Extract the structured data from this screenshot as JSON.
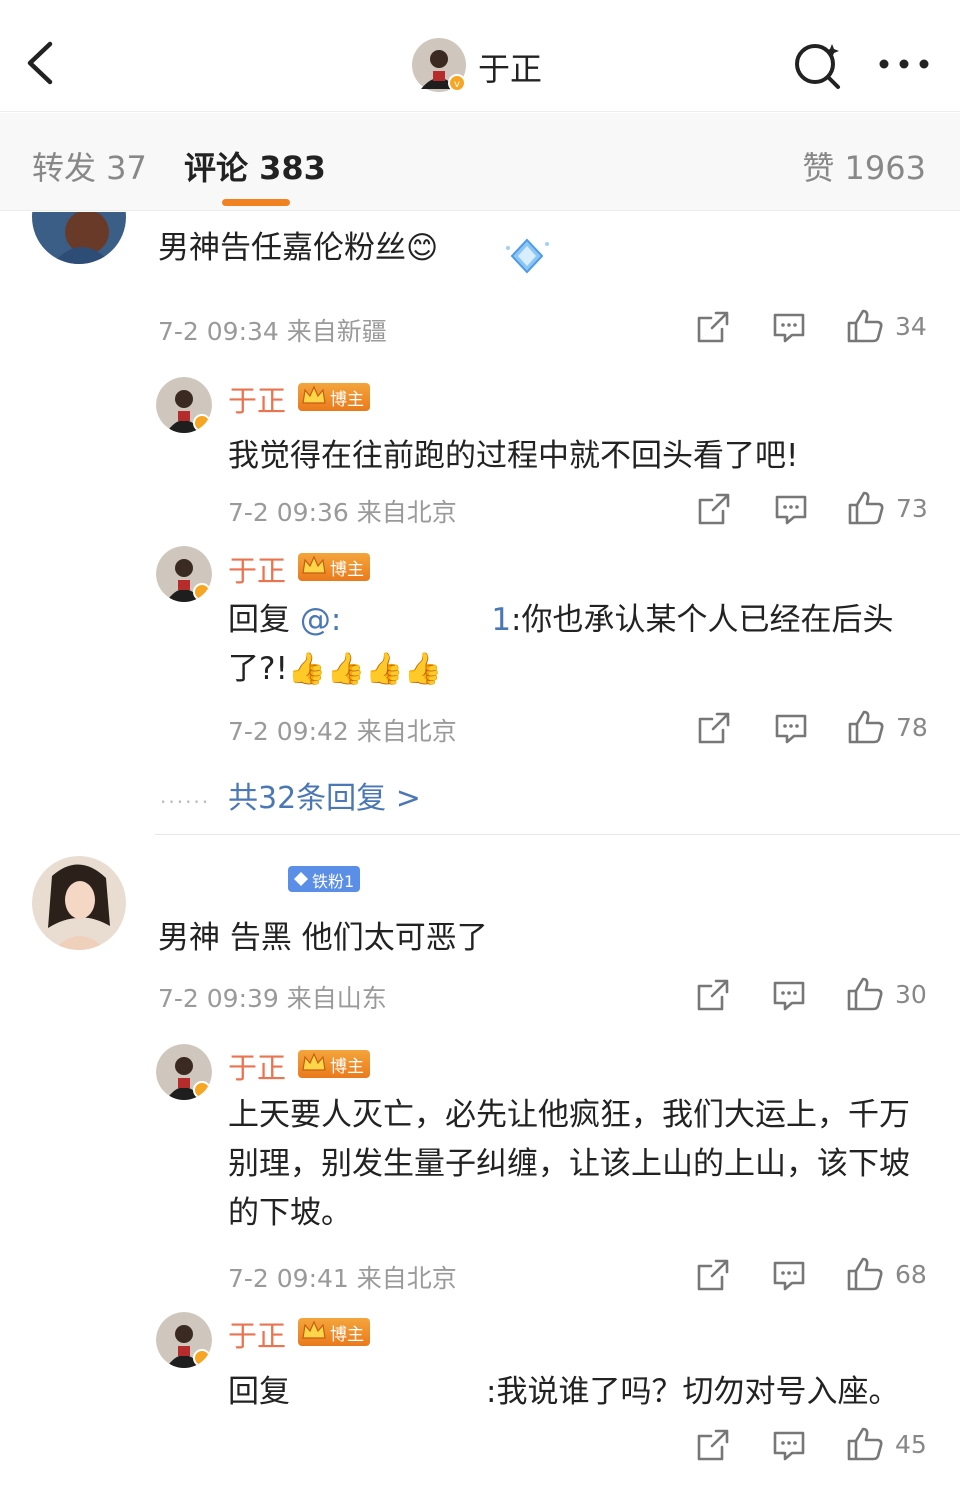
{
  "header": {
    "title": "于正"
  },
  "tabs": {
    "forward": "转发 37",
    "comments": "评论 383",
    "likes": "赞 1963"
  },
  "badges": {
    "blogger": "博主",
    "fan": "铁粉1"
  },
  "comments": [
    {
      "text": "男神告任嘉伦粉丝😊",
      "time": "7-2 09:34 来自新疆",
      "likes": "34",
      "replies": [
        {
          "author": "于正",
          "text": "我觉得在往前跑的过程中就不回头看了吧!",
          "time": "7-2 09:36 来自北京",
          "likes": "73"
        },
        {
          "author": "于正",
          "prefix": "回复",
          "mention": "@:",
          "mention_tail": "1",
          "text": ":你也承认某个人已经在后头了?!👍👍👍👍",
          "time": "7-2 09:42 来自北京",
          "likes": "78"
        }
      ],
      "more_replies": "共32条回复 >"
    },
    {
      "text": "男神 告黑 他们太可恶了",
      "time": "7-2 09:39 来自山东",
      "likes": "30",
      "replies": [
        {
          "author": "于正",
          "text": "上天要人灭亡，必先让他疯狂，我们大运上，千万别理，别发生量子纠缠，让该上山的上山，该下坡的下坡。",
          "time": "7-2 09:41 来自北京",
          "likes": "68"
        },
        {
          "author": "于正",
          "prefix": "回复",
          "text": ":我说谁了吗？切勿对号入座。",
          "likes": "45"
        }
      ]
    }
  ],
  "colors": {
    "accent": "#f08221",
    "blogger_name": "#eb7350",
    "link": "#4a77b6",
    "meta": "#9a9a9a"
  }
}
